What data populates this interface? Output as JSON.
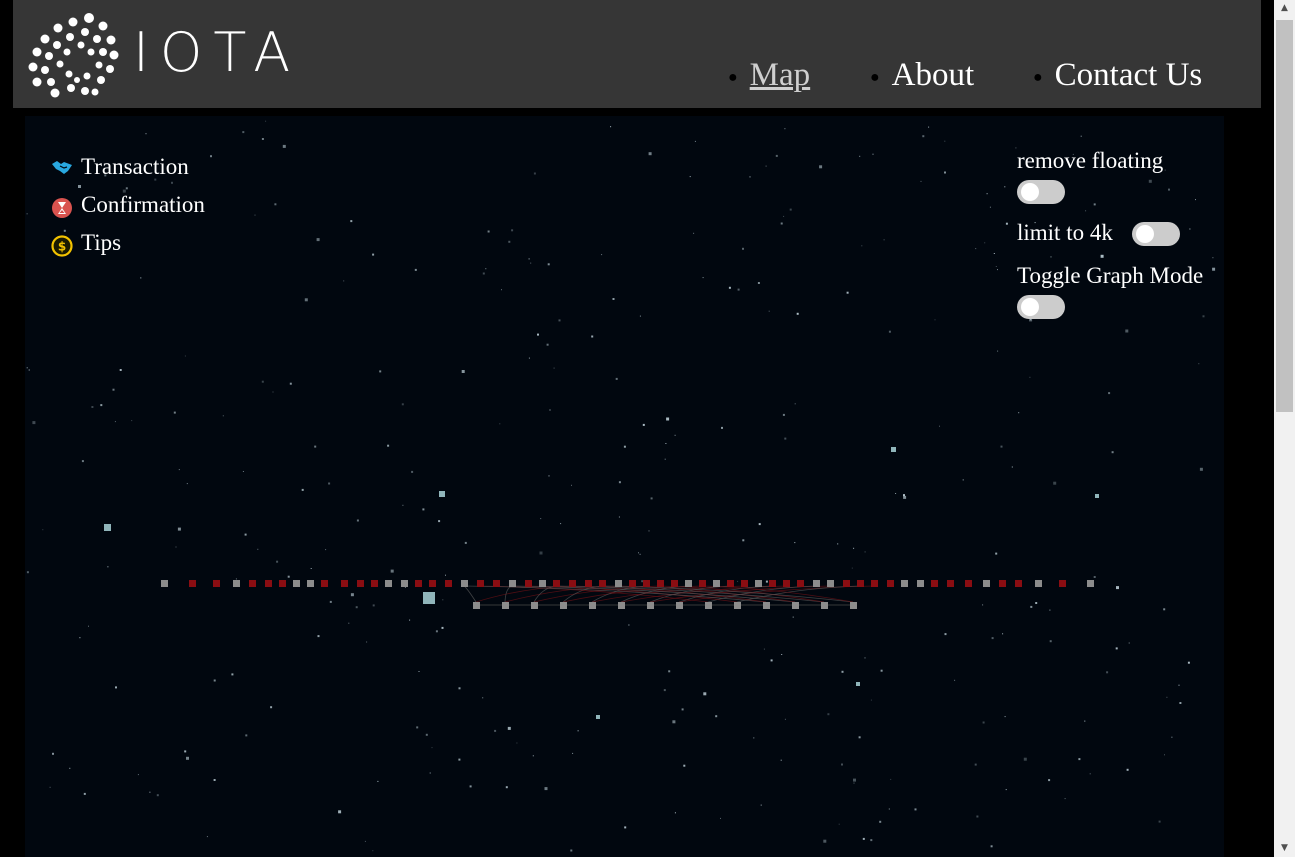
{
  "header": {
    "logo_text": "IOTA",
    "nav": [
      {
        "label": "Map",
        "active": true
      },
      {
        "label": "About",
        "active": false
      },
      {
        "label": "Contact Us",
        "active": false
      }
    ]
  },
  "legend": [
    {
      "label": "Transaction",
      "icon": "handshake-icon",
      "color": "#29a8e0"
    },
    {
      "label": "Confirmation",
      "icon": "hourglass-icon",
      "color": "#d9534f"
    },
    {
      "label": "Tips",
      "icon": "dollar-coin-icon",
      "color": "#f2c200"
    }
  ],
  "controls": {
    "remove_floating": {
      "label": "remove floating",
      "on": false
    },
    "limit_4k": {
      "label": "limit to 4k",
      "on": false
    },
    "graph_mode": {
      "label": "Toggle Graph Mode",
      "on": false
    }
  },
  "colors": {
    "header_bg": "#363636",
    "canvas_bg": "#01070f",
    "node_confirmed": "#8a0d12",
    "node_pending": "#8c8c8c",
    "toggle_off": "#cccccc"
  }
}
